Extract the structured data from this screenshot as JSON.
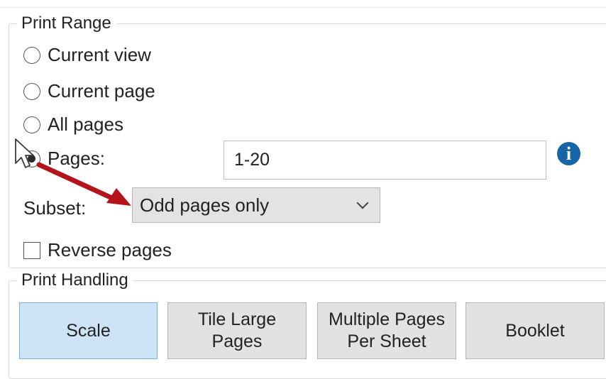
{
  "print_range": {
    "legend": "Print Range",
    "options": [
      {
        "label": "Current view",
        "selected": false
      },
      {
        "label": "Current page",
        "selected": false
      },
      {
        "label": "All pages",
        "selected": false
      },
      {
        "label": "Pages:",
        "selected": true
      }
    ],
    "pages_value": "1-20",
    "subset_label": "Subset:",
    "subset_value": "Odd pages only",
    "reverse_label": "Reverse pages",
    "reverse_checked": false
  },
  "print_handling": {
    "legend": "Print Handling",
    "buttons": [
      {
        "label": "Scale",
        "selected": true
      },
      {
        "label": "Tile Large\nPages",
        "selected": false
      },
      {
        "label": "Multiple Pages\nPer Sheet",
        "selected": false
      },
      {
        "label": "Booklet",
        "selected": false
      }
    ]
  },
  "info_icon": "i",
  "colors": {
    "accent_arrow": "#b5141b",
    "info": "#1565a8",
    "selected_button": "#cfe3f6"
  }
}
